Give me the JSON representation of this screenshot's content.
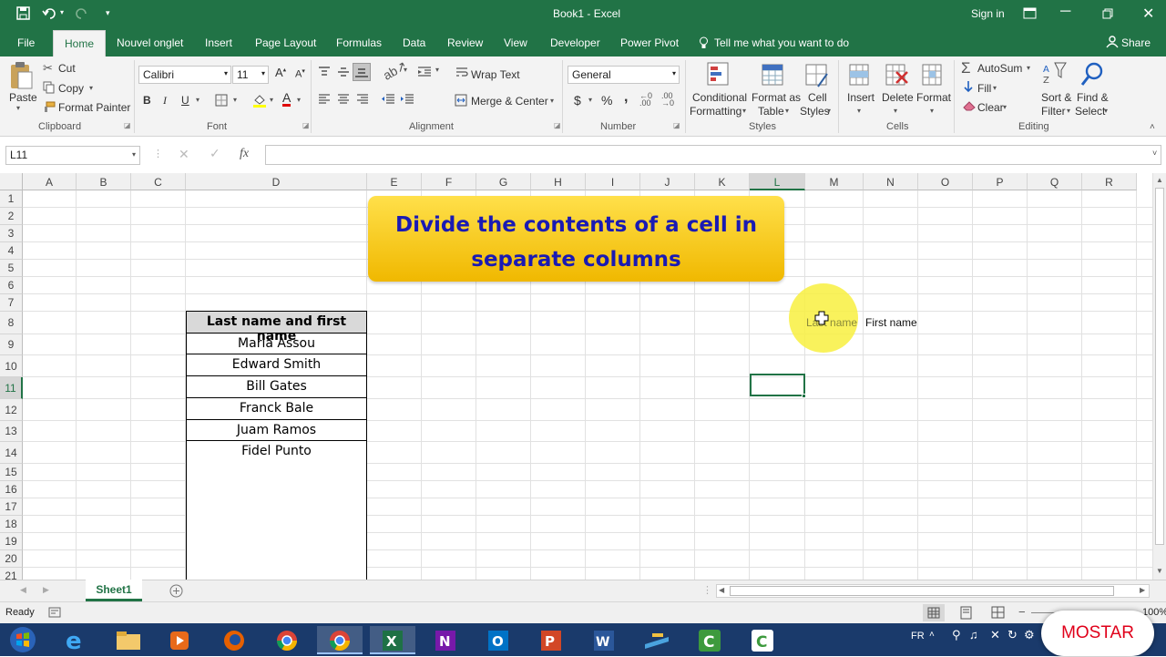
{
  "window": {
    "title": "Book1 - Excel",
    "sign_in": "Sign in"
  },
  "colors": {
    "accent": "#217346",
    "banner_bg": "#f5c400",
    "banner_text": "#1a1ab3",
    "highlight": "#f8f040"
  },
  "ribbon_tabs": [
    "File",
    "Home",
    "Nouvel onglet",
    "Insert",
    "Page Layout",
    "Formulas",
    "Data",
    "Review",
    "View",
    "Developer",
    "Power Pivot"
  ],
  "tell_me": "Tell me what you want to do",
  "share": "Share",
  "clipboard": {
    "paste": "Paste",
    "cut": "Cut",
    "copy": "Copy",
    "format_painter": "Format Painter",
    "group": "Clipboard"
  },
  "font": {
    "name": "Calibri",
    "size": "11",
    "bold": "B",
    "italic": "I",
    "underline": "U",
    "group": "Font"
  },
  "alignment": {
    "wrap_text": "Wrap Text",
    "merge_center": "Merge & Center",
    "group": "Alignment"
  },
  "number": {
    "format": "General",
    "currency": "$",
    "percent": "%",
    "comma": ",",
    "group": "Number"
  },
  "styles": {
    "conditional": "Conditional",
    "formatting": "Formatting",
    "format_as": "Format as",
    "table": "Table",
    "cell": "Cell",
    "cell_styles": "Styles",
    "group": "Styles"
  },
  "cells": {
    "insert": "Insert",
    "delete": "Delete",
    "format": "Format",
    "group": "Cells"
  },
  "editing": {
    "autosum": "AutoSum",
    "fill": "Fill",
    "clear": "Clear",
    "sort": "Sort &",
    "filter": "Filter",
    "find": "Find &",
    "select": "Select",
    "group": "Editing"
  },
  "namebox": "L11",
  "fx": "fx",
  "columns": [
    "A",
    "B",
    "C",
    "D",
    "E",
    "F",
    "G",
    "H",
    "I",
    "J",
    "K",
    "L",
    "M",
    "N",
    "O",
    "P",
    "Q",
    "R"
  ],
  "rows": [
    "1",
    "2",
    "3",
    "4",
    "5",
    "6",
    "7",
    "8",
    "9",
    "10",
    "11",
    "12",
    "13",
    "14",
    "15",
    "16",
    "17",
    "18",
    "19",
    "20",
    "21"
  ],
  "banner": {
    "line1": "Divide the contents of a cell in",
    "line2": "separate columns"
  },
  "table": {
    "header": "Last name and first name",
    "items": [
      "Maria Assou",
      "Edward Smith",
      "Bill Gates",
      "Franck Bale",
      "Juam Ramos",
      "Fidel Punto"
    ]
  },
  "side_headers": {
    "last_name": "Last name",
    "first_name": "First name"
  },
  "sheet_tab": "Sheet1",
  "status": {
    "ready": "Ready",
    "zoom": "100%"
  },
  "taskbar": {
    "lang": "FR",
    "watermark": "MOSTAR"
  }
}
